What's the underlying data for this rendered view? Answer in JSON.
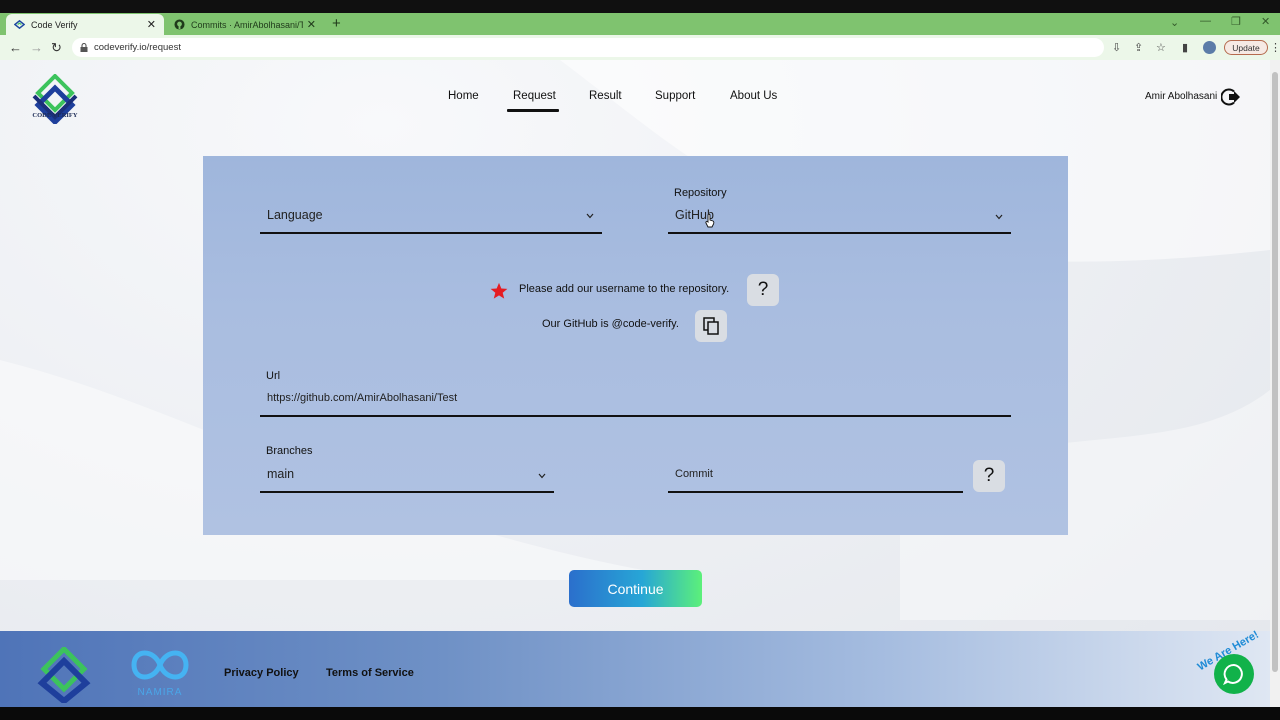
{
  "browser": {
    "tabs": [
      {
        "title": "Code Verify",
        "active": true
      },
      {
        "title": "Commits · AmirAbolhasani/Test",
        "active": false
      }
    ],
    "url": "codeverify.io/request",
    "update_label": "Update"
  },
  "header": {
    "logo_text": "CODE VERIFY",
    "nav": [
      "Home",
      "Request",
      "Result",
      "Support",
      "About Us"
    ],
    "active_nav": "Request",
    "user_name": "Amir Abolhasani"
  },
  "form": {
    "language": {
      "value": "Language"
    },
    "repository": {
      "label": "Repository",
      "value": "GitHub"
    },
    "notice": "Please add our username to the repository.",
    "github_note": "Our GitHub is @code-verify.",
    "help_glyph": "?",
    "url": {
      "label": "Url",
      "value": "https://github.com/AmirAbolhasani/Test"
    },
    "branches": {
      "label": "Branches",
      "value": "main"
    },
    "commit": {
      "placeholder": "Commit"
    },
    "continue_label": "Continue"
  },
  "footer": {
    "namira_text": "NAMIRA",
    "links": [
      "Privacy Policy",
      "Terms of Service"
    ],
    "chat_text": "We Are Here!"
  },
  "colors": {
    "accent_green": "#5cf07a",
    "accent_blue": "#2b6fcc",
    "star_red": "#e51c23",
    "chat_green": "#11b24a"
  },
  "icons": [
    "code-verify-logo-icon",
    "github-favicon-icon",
    "lock-icon",
    "chevron-down-icon",
    "star-icon",
    "question-icon",
    "copy-icon",
    "logout-icon",
    "chat-icon",
    "namira-logo-icon"
  ]
}
